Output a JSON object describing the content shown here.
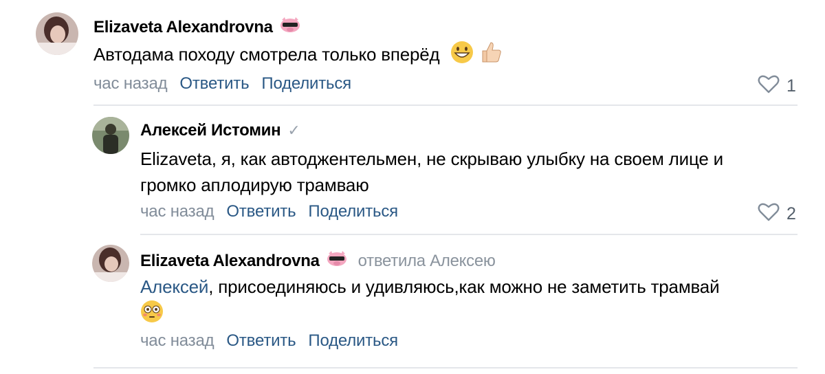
{
  "comments": [
    {
      "author": "Elizaveta Alexandrovna",
      "text": "Автодама походу смотрела только вперёд",
      "time": "час назад",
      "reply_label": "Ответить",
      "share_label": "Поделиться",
      "likes": "1",
      "emoji": [
        "grinning-face",
        "thumbs-up"
      ]
    },
    {
      "author": "Алексей Истомин",
      "verified": "✓",
      "text_line1": "Elizaveta, я, как автоджентельмен, не скрываю улыбку на своем лице и",
      "text_line2": "громко аплодирую трамваю",
      "time": "час назад",
      "reply_label": "Ответить",
      "share_label": "Поделиться",
      "likes": "2"
    },
    {
      "author": "Elizaveta Alexandrovna",
      "replied_to": "ответила Алексею",
      "mention": "Алексей",
      "text": ", присоединяюсь и удивляюсь,как можно не заметить трамвай",
      "time": "час назад",
      "reply_label": "Ответить",
      "share_label": "Поделиться",
      "emoji": [
        "flushed-face"
      ]
    }
  ],
  "colors": {
    "link": "#2a5885",
    "meta": "#818c99",
    "divider": "#e4e6ea"
  }
}
